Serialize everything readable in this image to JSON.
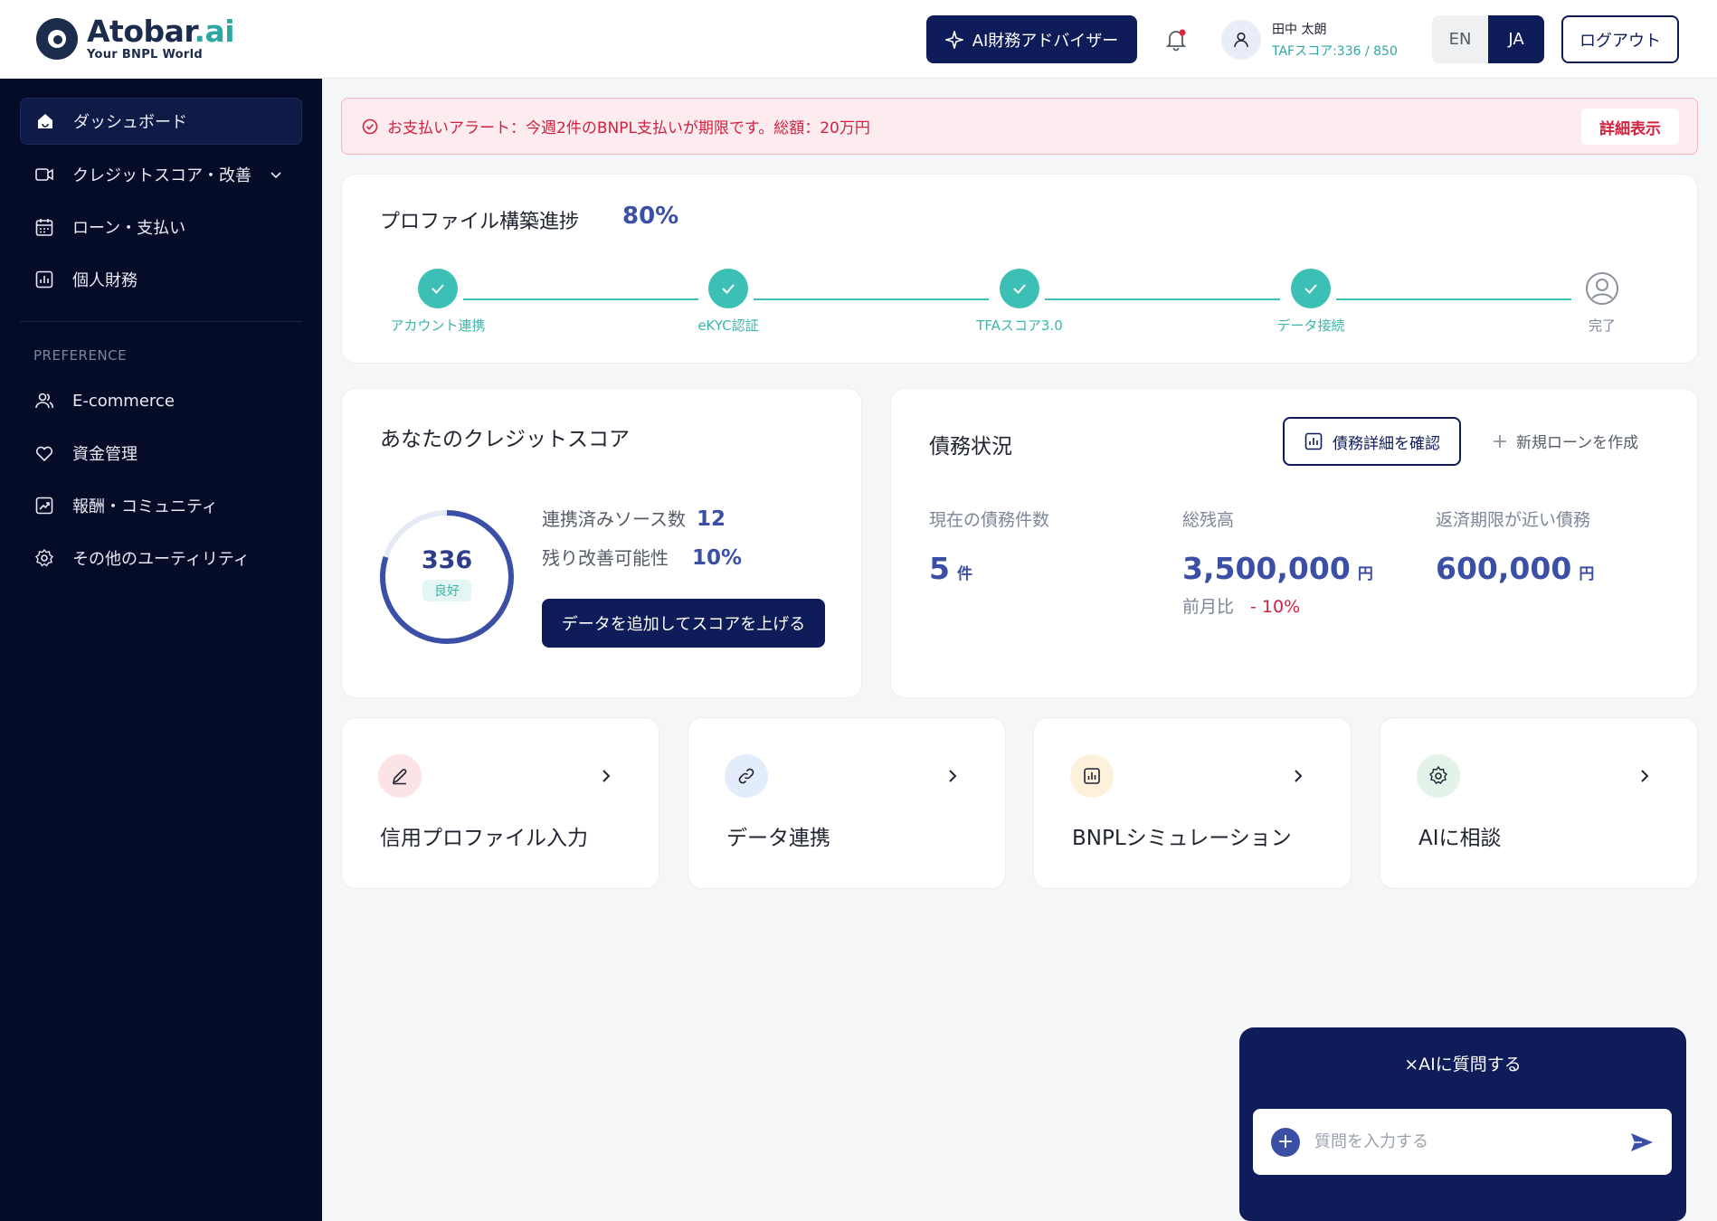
{
  "header": {
    "logo_name": "Atobar",
    "logo_suffix": ".ai",
    "logo_tagline": "Your BNPL World",
    "advisor_label": "AI財務アドバイザー",
    "user_name": "田中 太朗",
    "user_score": "TAFスコア:336 / 850",
    "lang_en": "EN",
    "lang_ja": "JA",
    "logout_label": "ログアウト"
  },
  "sidebar": {
    "items": [
      {
        "label": "ダッシュボード",
        "icon": "home-icon"
      },
      {
        "label": "クレジットスコア・改善",
        "icon": "video-icon"
      },
      {
        "label": "ローン・支払い",
        "icon": "calendar-icon"
      },
      {
        "label": "個人財務",
        "icon": "chart-icon"
      }
    ],
    "section_label": "PREFERENCE",
    "pref_items": [
      {
        "label": "E-commerce",
        "icon": "users-icon"
      },
      {
        "label": "資金管理",
        "icon": "heart-icon"
      },
      {
        "label": "報酬・コミュニティ",
        "icon": "growth-chart-icon"
      },
      {
        "label": "その他のユーティリティ",
        "icon": "gear-icon"
      }
    ]
  },
  "alert": {
    "text": "お支払いアラート：今週2件のBNPL支払いが期限です。総額：20万円",
    "button_label": "詳細表示"
  },
  "progress": {
    "title": "プロファイル構築進捗",
    "percent": "80%",
    "steps": [
      {
        "label": "アカウント連携",
        "done": true
      },
      {
        "label": "eKYC認証",
        "done": true
      },
      {
        "label": "TFAスコア3.0",
        "done": true
      },
      {
        "label": "データ接続",
        "done": true
      },
      {
        "label": "完了",
        "done": false
      }
    ]
  },
  "credit_score": {
    "title": "あなたのクレジットスコア",
    "score": "336",
    "rating": "良好",
    "score_fraction": 0.8,
    "sources_label": "連携済みソース数",
    "sources_value": "12",
    "improve_label": "残り改善可能性",
    "improve_value": "10%",
    "button_label": "データを追加してスコアを上げる"
  },
  "debt": {
    "title": "債務状況",
    "details_button": "債務詳細を確認",
    "new_loan_button": "新規ローンを作成",
    "count_label": "現在の債務件数",
    "count_value": "5",
    "count_unit": "件",
    "balance_label": "総残高",
    "balance_value": "3,500,000",
    "balance_unit": "円",
    "mom_label": "前月比",
    "mom_value": "- 10%",
    "due_label": "返済期限が近い債務",
    "due_value": "600,000",
    "due_unit": "円"
  },
  "quick_actions": [
    {
      "label": "信用プロファイル入力",
      "icon": "pencil-icon",
      "bg": "#fbe3e6"
    },
    {
      "label": "データ連携",
      "icon": "link-icon",
      "bg": "#e3ecfb"
    },
    {
      "label": "BNPLシミュレーション",
      "icon": "bar-chart-icon",
      "bg": "#fdf1dc"
    },
    {
      "label": "AIに相談",
      "icon": "ai-icon",
      "bg": "#e3f3ea"
    }
  ],
  "chat": {
    "title": "×AIに質問する",
    "placeholder": "質問を入力する"
  }
}
